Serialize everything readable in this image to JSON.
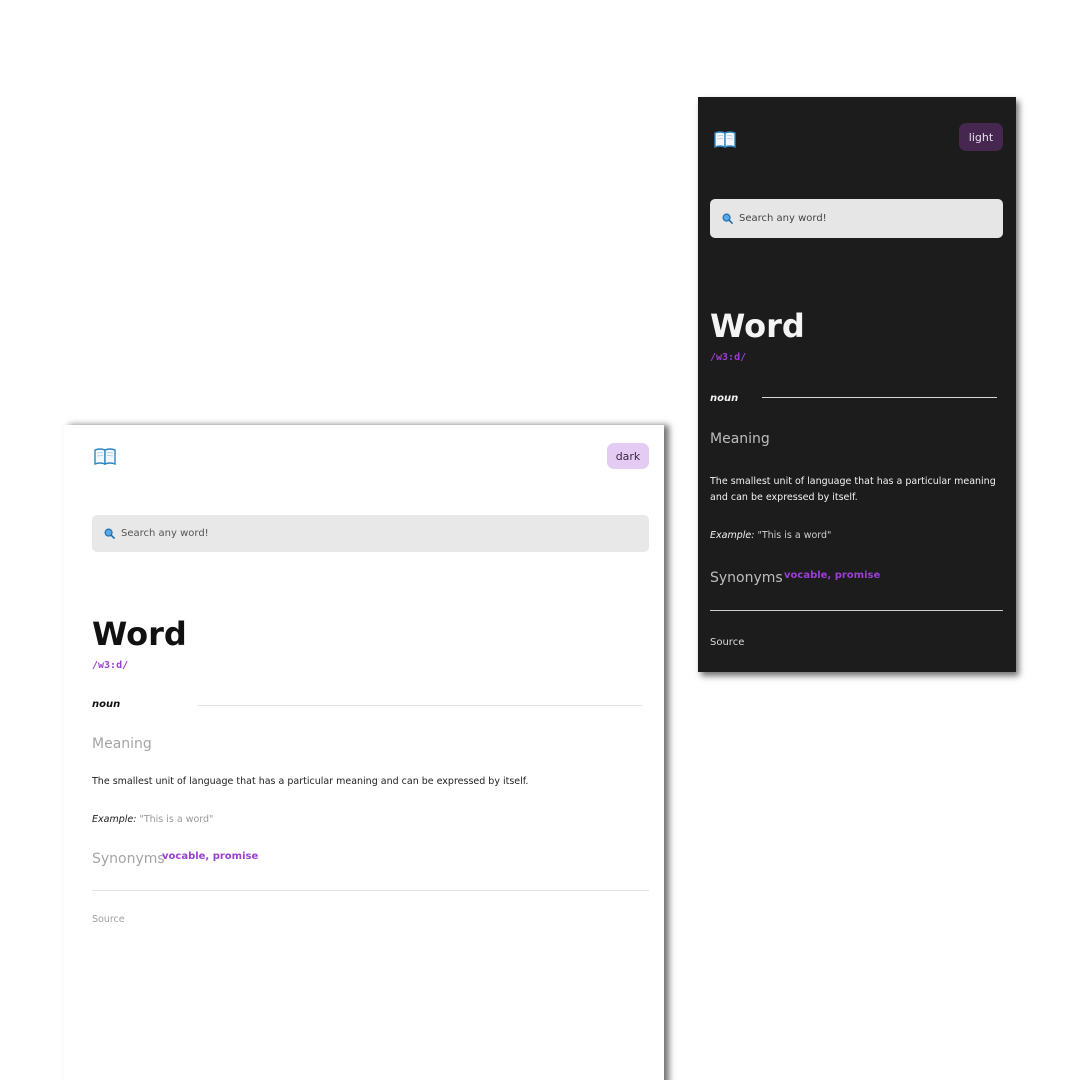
{
  "colors": {
    "accent_purple": "#9b3fd4",
    "light_background": "#ffffff",
    "dark_background": "#1c1c1c",
    "light_toggle_bg": "#e4cbf3",
    "dark_toggle_bg": "#45274f",
    "search_bg": "#e8e8e8"
  },
  "icons": {
    "logo": "open-book-icon",
    "search": "magnifier-icon"
  },
  "light_view": {
    "theme_toggle_label": "dark",
    "search_placeholder": "Search any word!",
    "word": "Word",
    "phonetic": "/w3:d/",
    "part_of_speech": "noun",
    "meaning_heading": "Meaning",
    "definition": "The smallest unit of language that has a particular meaning and can be expressed by itself.",
    "example_label": "Example:",
    "example_text": "\"This is a word\"",
    "synonyms_heading": "Synonyms",
    "synonyms": "vocable, promise",
    "source_label": "Source"
  },
  "dark_view": {
    "theme_toggle_label": "light",
    "search_placeholder": "Search any word!",
    "word": "Word",
    "phonetic": "/w3:d/",
    "part_of_speech": "noun",
    "meaning_heading": "Meaning",
    "definition": "The smallest unit of language that has a particular meaning and can be expressed by itself.",
    "example_label": "Example:",
    "example_text": "\"This is a word\"",
    "synonyms_heading": "Synonyms",
    "synonyms": "vocable, promise",
    "source_label": "Source"
  }
}
